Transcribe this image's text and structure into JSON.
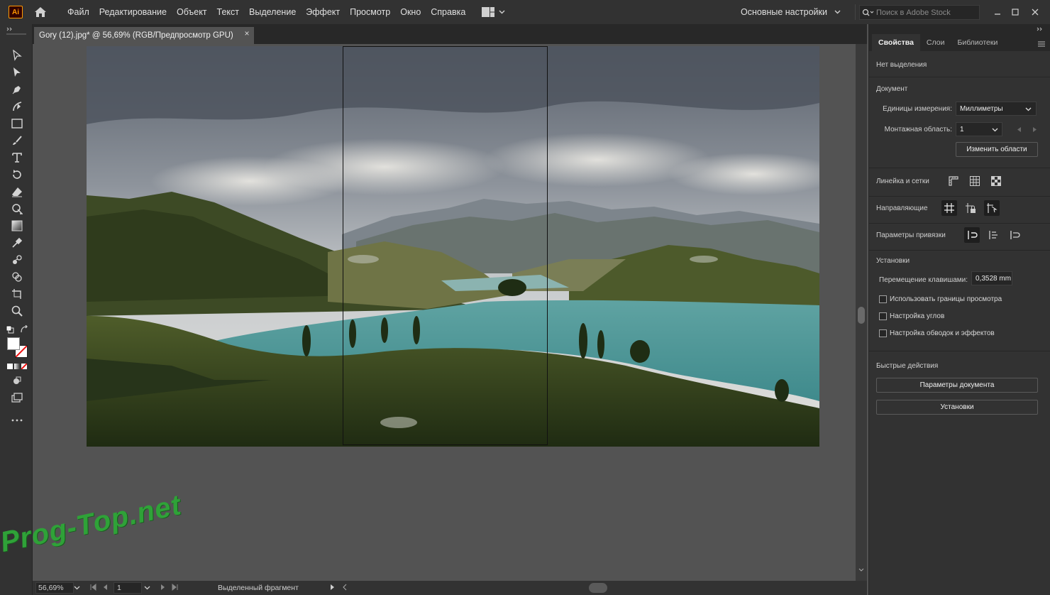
{
  "app": {
    "logo_text": "Ai"
  },
  "menu": [
    "Файл",
    "Редактирование",
    "Объект",
    "Текст",
    "Выделение",
    "Эффект",
    "Просмотр",
    "Окно",
    "Справка"
  ],
  "workspace": "Основные настройки",
  "search": {
    "placeholder": "Поиск в Adobe Stock"
  },
  "document_tab": {
    "title": "Gory (12).jpg* @ 56,69% (RGB/Предпросмотр GPU)",
    "close": "×"
  },
  "status": {
    "zoom": "56,69%",
    "artboard_number": "1",
    "tool_info": "Выделенный фрагмент"
  },
  "panel": {
    "tabs": [
      "Свойства",
      "Слои",
      "Библиотеки"
    ],
    "no_selection": "Нет выделения",
    "document": {
      "heading": "Документ",
      "units_label": "Единицы измерения:",
      "units_value": "Миллиметры",
      "artboard_label": "Монтажная область:",
      "artboard_value": "1",
      "edit_artboards": "Изменить области"
    },
    "rulers": {
      "heading": "Линейка и сетки"
    },
    "guides": {
      "heading": "Направляющие"
    },
    "snap": {
      "heading": "Параметры привязки"
    },
    "prefs": {
      "heading": "Установки",
      "keyboard_increment_label": "Перемещение клавишами:",
      "keyboard_increment_value": "0,3528 mm",
      "checkboxes": [
        "Использовать границы просмотра",
        "Настройка углов",
        "Настройка обводок и эффектов"
      ]
    },
    "quick_actions": {
      "heading": "Быстрые действия",
      "document_setup": "Параметры документа",
      "preferences": "Установки"
    }
  },
  "watermark": "Prog-Top.net"
}
